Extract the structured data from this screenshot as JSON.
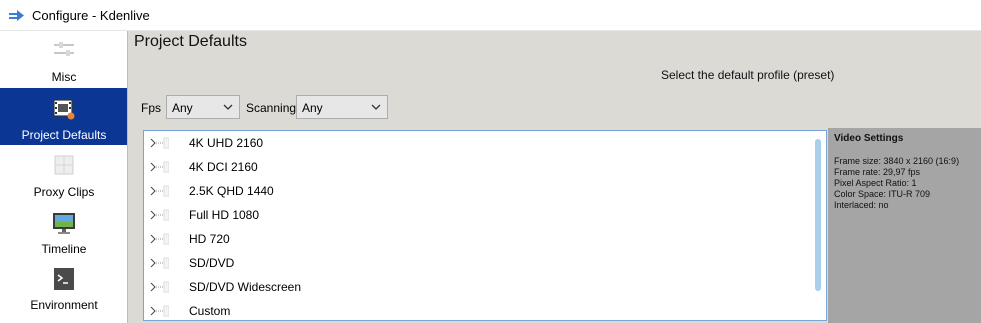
{
  "window": {
    "title": "Configure - Kdenlive"
  },
  "sidebar": {
    "items": [
      {
        "label": "Misc"
      },
      {
        "label": "Project Defaults"
      },
      {
        "label": "Proxy Clips"
      },
      {
        "label": "Timeline"
      },
      {
        "label": "Environment"
      }
    ]
  },
  "main": {
    "title": "Project Defaults",
    "profile_hint": "Select the default profile (preset)",
    "fps": {
      "label": "Fps",
      "value": "Any"
    },
    "scanning": {
      "label": "Scanning",
      "value": "Any"
    },
    "profiles": [
      {
        "label": "4K UHD 2160"
      },
      {
        "label": "4K DCI 2160"
      },
      {
        "label": "2.5K QHD 1440"
      },
      {
        "label": "Full HD 1080"
      },
      {
        "label": "HD 720"
      },
      {
        "label": "SD/DVD"
      },
      {
        "label": "SD/DVD Widescreen"
      },
      {
        "label": "Custom"
      }
    ]
  },
  "video_settings": {
    "title": "Video Settings",
    "lines": [
      "Frame size: 3840 x 2160 (16:9)",
      "Frame rate: 29,97 fps",
      "Pixel Aspect Ratio: 1",
      "Color Space: ITU-R 709",
      "Interlaced: no"
    ]
  },
  "colors": {
    "selected_sidebar": "#0b3694",
    "panel_gray": "#a5a5a5",
    "scrollbar": "#a9d0ea"
  }
}
